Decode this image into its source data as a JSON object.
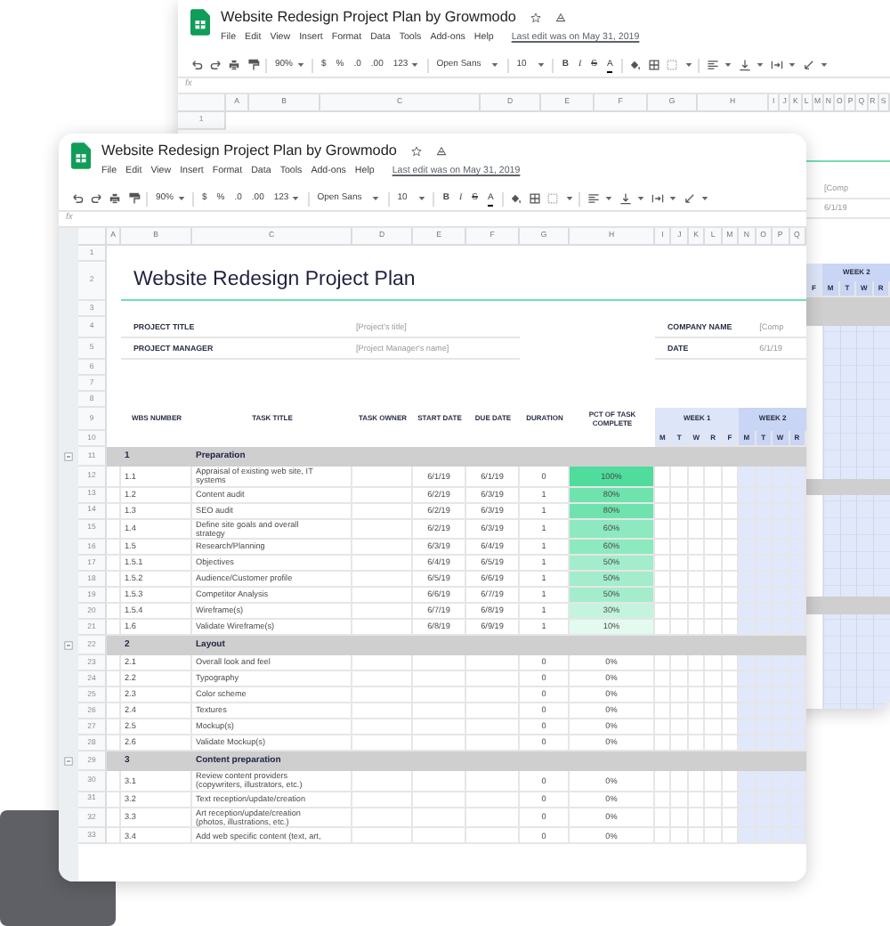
{
  "back_window": {
    "title": "Website Redesign Project Plan by Growmodo",
    "menu": [
      "File",
      "Edit",
      "View",
      "Insert",
      "Format",
      "Data",
      "Tools",
      "Add-ons",
      "Help"
    ],
    "last_edit": "Last edit was on May 31, 2019",
    "toolbar": {
      "zoom": "90%",
      "currency": "$",
      "percent": "%",
      "decimal_less": ".0",
      "decimal_more": ".00",
      "format": "123",
      "font": "Open Sans",
      "size": "10",
      "bold": "B",
      "italic": "I",
      "strike": "S",
      "text_color": "A"
    },
    "formula_label": "fx",
    "column_headers": [
      "A",
      "B",
      "C",
      "D",
      "E",
      "F",
      "G",
      "H",
      "I",
      "J",
      "K",
      "L",
      "M",
      "N",
      "O",
      "P",
      "Q",
      "R",
      "S"
    ],
    "row_numbers": [
      "1"
    ],
    "strip": {
      "company_value": "[Comp",
      "date_value": "6/1/19",
      "week": "WEEK 2",
      "days": [
        "F",
        "M",
        "T",
        "W",
        "R"
      ]
    }
  },
  "front_window": {
    "title": "Website Redesign Project Plan by Growmodo",
    "menu": [
      "File",
      "Edit",
      "View",
      "Insert",
      "Format",
      "Data",
      "Tools",
      "Add-ons",
      "Help"
    ],
    "last_edit": "Last edit was on May 31, 2019",
    "toolbar": {
      "zoom": "90%",
      "currency": "$",
      "percent": "%",
      "decimal_less": ".0",
      "decimal_more": ".00",
      "format": "123",
      "font": "Open Sans",
      "size": "10",
      "bold": "B",
      "italic": "I",
      "strike": "S",
      "text_color": "A"
    },
    "formula_label": "fx",
    "column_headers": [
      "A",
      "B",
      "C",
      "D",
      "E",
      "F",
      "G",
      "H",
      "I",
      "J",
      "K",
      "L",
      "M",
      "N",
      "O",
      "P",
      "Q"
    ],
    "rows": [
      {
        "number": "1",
        "kind": "blank"
      },
      {
        "number": "2",
        "kind": "title",
        "title": "Website Redesign Project Plan"
      },
      {
        "number": "3",
        "kind": "blank"
      },
      {
        "number": "4",
        "kind": "field",
        "left_label": "PROJECT TITLE",
        "left_value": "[Project's title]",
        "right_label": "COMPANY NAME",
        "right_value": "[Comp"
      },
      {
        "number": "5",
        "kind": "field",
        "left_label": "PROJECT MANAGER",
        "left_value": "[Project Manager's name]",
        "right_label": "DATE",
        "right_value": "6/1/19"
      },
      {
        "number": "6",
        "kind": "blank"
      },
      {
        "number": "7",
        "kind": "blank"
      },
      {
        "number": "8",
        "kind": "blank"
      },
      {
        "number": "9",
        "kind": "header",
        "columns": [
          "WBS NUMBER",
          "TASK TITLE",
          "TASK OWNER",
          "START DATE",
          "DUE DATE",
          "DURATION",
          "PCT OF TASK COMPLETE"
        ],
        "weeks": [
          "WEEK 1",
          "WEEK 2"
        ]
      },
      {
        "number": "10",
        "kind": "days",
        "days": [
          "M",
          "T",
          "W",
          "R",
          "F",
          "M",
          "T",
          "W",
          "R"
        ]
      },
      {
        "number": "11",
        "kind": "section",
        "wbs": "1",
        "title": "Preparation"
      },
      {
        "number": "12",
        "kind": "task",
        "wbs": "1.1",
        "title": "Appraisal of existing web site, IT systems",
        "start": "6/1/19",
        "due": "6/1/19",
        "duration": "0",
        "pct": "100%",
        "color": "#4fdc9c"
      },
      {
        "number": "13",
        "kind": "task",
        "wbs": "1.2",
        "title": "Content audit",
        "start": "6/2/19",
        "due": "6/3/19",
        "duration": "1",
        "pct": "80%",
        "color": "#6ee3ae"
      },
      {
        "number": "14",
        "kind": "task",
        "wbs": "1.3",
        "title": "SEO audit",
        "start": "6/2/19",
        "due": "6/3/19",
        "duration": "1",
        "pct": "80%",
        "color": "#6ee3ae"
      },
      {
        "number": "15",
        "kind": "task",
        "wbs": "1.4",
        "title": "Define site goals and overall strategy",
        "start": "6/2/19",
        "due": "6/3/19",
        "duration": "1",
        "pct": "60%",
        "color": "#8de9bf"
      },
      {
        "number": "16",
        "kind": "task",
        "wbs": "1.5",
        "title": "Research/Planning",
        "start": "6/3/19",
        "due": "6/4/19",
        "duration": "1",
        "pct": "60%",
        "color": "#8de9bf"
      },
      {
        "number": "17",
        "kind": "task",
        "wbs": "1.5.1",
        "title": "Objectives",
        "start": "6/4/19",
        "due": "6/5/19",
        "duration": "1",
        "pct": "50%",
        "color": "#a3edcc"
      },
      {
        "number": "18",
        "kind": "task",
        "wbs": "1.5.2",
        "title": "Audience/Customer profile",
        "start": "6/5/19",
        "due": "6/6/19",
        "duration": "1",
        "pct": "50%",
        "color": "#a3edcc"
      },
      {
        "number": "19",
        "kind": "task",
        "wbs": "1.5.3",
        "title": "Competitor Analysis",
        "start": "6/6/19",
        "due": "6/7/19",
        "duration": "1",
        "pct": "50%",
        "color": "#a3edcc"
      },
      {
        "number": "20",
        "kind": "task",
        "wbs": "1.5.4",
        "title": "Wireframe(s)",
        "start": "6/7/19",
        "due": "6/8/19",
        "duration": "1",
        "pct": "30%",
        "color": "#c4f4de"
      },
      {
        "number": "21",
        "kind": "task",
        "wbs": "1.6",
        "title": "Validate Wireframe(s)",
        "start": "6/8/19",
        "due": "6/9/19",
        "duration": "1",
        "pct": "10%",
        "color": "#e3faef"
      },
      {
        "number": "22",
        "kind": "section",
        "wbs": "2",
        "title": "Layout"
      },
      {
        "number": "23",
        "kind": "task",
        "wbs": "2.1",
        "title": "Overall look and feel",
        "duration": "0",
        "pct": "0%"
      },
      {
        "number": "24",
        "kind": "task",
        "wbs": "2.2",
        "title": "Typography",
        "duration": "0",
        "pct": "0%"
      },
      {
        "number": "25",
        "kind": "task",
        "wbs": "2.3",
        "title": "Color scheme",
        "duration": "0",
        "pct": "0%"
      },
      {
        "number": "26",
        "kind": "task",
        "wbs": "2.4",
        "title": "Textures",
        "duration": "0",
        "pct": "0%"
      },
      {
        "number": "27",
        "kind": "task",
        "wbs": "2.5",
        "title": "Mockup(s)",
        "duration": "0",
        "pct": "0%"
      },
      {
        "number": "28",
        "kind": "task",
        "wbs": "2.6",
        "title": "Validate Mockup(s)",
        "duration": "0",
        "pct": "0%"
      },
      {
        "number": "29",
        "kind": "section",
        "wbs": "3",
        "title": "Content preparation"
      },
      {
        "number": "30",
        "kind": "task",
        "wbs": "3.1",
        "title": "Review content providers (copywriters, illustrators, etc.)",
        "duration": "0",
        "pct": "0%"
      },
      {
        "number": "31",
        "kind": "task",
        "wbs": "3.2",
        "title": "Text reception/update/creation",
        "duration": "0",
        "pct": "0%"
      },
      {
        "number": "32",
        "kind": "task",
        "wbs": "3.3",
        "title": "Art reception/update/creation (photos, illustrations, etc.)",
        "duration": "0",
        "pct": "0%"
      },
      {
        "number": "33",
        "kind": "task",
        "wbs": "3.4",
        "title": "Add web specific content (text, art,",
        "duration": "0",
        "pct": "0%"
      }
    ]
  }
}
